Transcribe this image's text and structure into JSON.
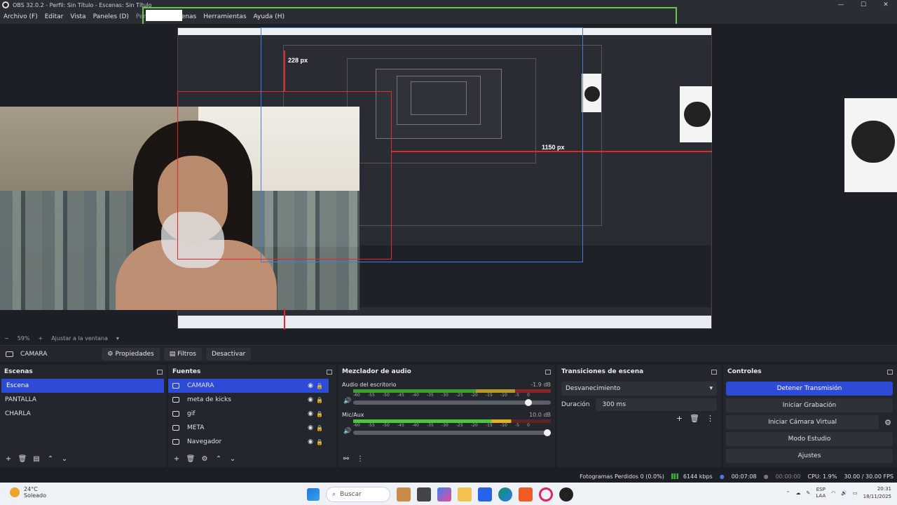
{
  "window": {
    "title": "OBS 32.0.2 - Perfil: Sin Título - Escenas: Sin Título",
    "controls": [
      "—",
      "☐",
      "✕"
    ]
  },
  "menu": [
    "Archivo (F)",
    "Editar",
    "Vista",
    "Paneles (D)",
    "Perfil",
    "Escenas",
    "Herramientas",
    "Ayuda (H)"
  ],
  "preview": {
    "label_228": "228 px",
    "label_1150": "1150 px"
  },
  "zoom": {
    "minus": "−",
    "value": "59%",
    "plus": "+",
    "fit_label": "Ajustar a la ventana"
  },
  "source_toolbar": {
    "source_name": "CAMARA",
    "properties": "Propiedades",
    "filters": "Filtros",
    "deactivate": "Desactivar"
  },
  "scenes": {
    "title": "Escenas",
    "items": [
      "Escena",
      "PANTALLA",
      "CHARLA"
    ],
    "selected": 0
  },
  "sources": {
    "title": "Fuentes",
    "items": [
      "CAMARA",
      "meta de kicks",
      "gif",
      "META",
      "Navegador"
    ]
  },
  "mixer": {
    "title": "Mezclador de audio",
    "channels": [
      {
        "name": "Audio del escritorio",
        "db": "-1.9 dB",
        "level": 0.62
      },
      {
        "name": "Mic/Aux",
        "db": "10.0 dB",
        "level": 0.72
      }
    ],
    "scale": [
      "-60",
      "-55",
      "-50",
      "-45",
      "-40",
      "-35",
      "-30",
      "-25",
      "-20",
      "-15",
      "-10",
      "-5",
      "0"
    ]
  },
  "transitions": {
    "title": "Transiciones de escena",
    "selected": "Desvanecimiento",
    "duration_label": "Duración",
    "duration_value": "300 ms"
  },
  "controls": {
    "title": "Controles",
    "buttons": [
      "Detener Transmisión",
      "Iniciar Grabación",
      "Iniciar Cámara Virtual",
      "Modo Estudio",
      "Ajustes"
    ]
  },
  "status": {
    "dropped": "Fotogramas Perdidos 0 (0.0%)",
    "bitrate": "6144 kbps",
    "stream_time": "00:07:08",
    "rec_time": "00:00:00",
    "cpu": "CPU: 1.9%",
    "fps": "30.00 / 30.00 FPS"
  },
  "taskbar": {
    "temp": "24°C",
    "weather": "Soleado",
    "search": "Buscar",
    "lang1": "ESP",
    "lang2": "LAA",
    "time": "20:31",
    "date": "18/11/2025"
  },
  "colors": {
    "accent": "#2e4bd8",
    "green_highlight": "#62c947",
    "red_guide": "#e02929"
  }
}
